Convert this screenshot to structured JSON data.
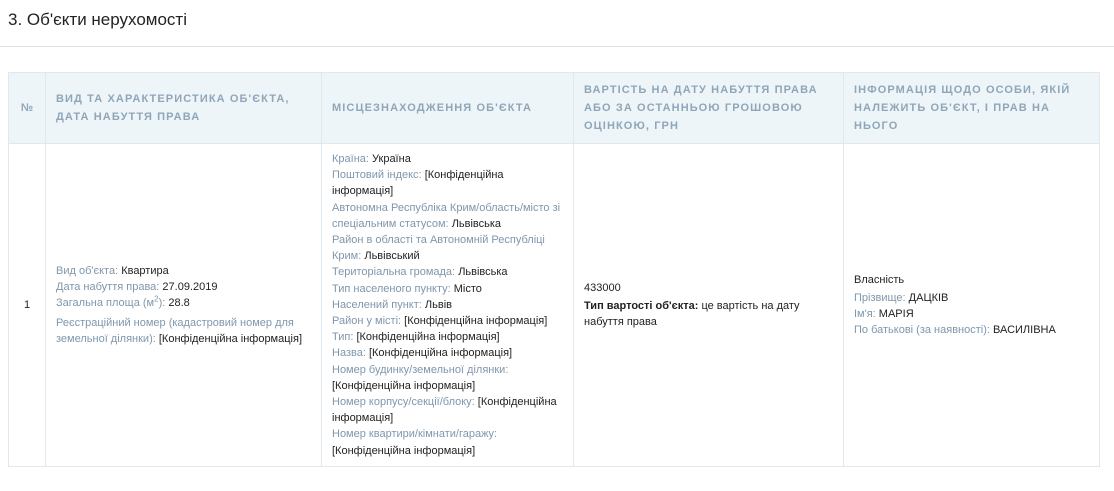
{
  "section": {
    "title": "3. Об'єкти нерухомості"
  },
  "table": {
    "headers": {
      "num": "№",
      "type": "Вид та характеристика об'єкта, дата набуття права",
      "location": "Місцезнаходження об'єкта",
      "value": "Вартість на дату набуття права або за останньою грошовою оцінкою, грн",
      "owner": "Інформація щодо особи, якій належить об'єкт, і прав на нього"
    },
    "row": {
      "num": "1",
      "type": {
        "object_type_label": "Вид об'єкта:",
        "object_type_value": "Квартира",
        "acq_date_label": "Дата набуття права:",
        "acq_date_value": "27.09.2019",
        "area_label": "Загальна площа (м",
        "area_sup": "2",
        "area_label_end": "):",
        "area_value": "28.8",
        "reg_label": "Реєстраційний номер (кадастровий номер для земельної ділянки):",
        "reg_value": "[Конфіденційна інформація]"
      },
      "location": {
        "country_label": "Країна:",
        "country_value": "Україна",
        "postal_label": "Поштовий індекс:",
        "postal_value": "[Конфіденційна інформація]",
        "region_label": "Автономна Республіка Крим/область/місто зі спеціальним статусом:",
        "region_value": "Львівська",
        "district_label": "Район в області та Автономній Республіці Крим:",
        "district_value": "Львівський",
        "community_label": "Територіальна громада:",
        "community_value": "Львівська",
        "settlement_type_label": "Тип населеного пункту:",
        "settlement_type_value": "Місто",
        "settlement_label": "Населений пункт:",
        "settlement_value": "Львів",
        "city_district_label": "Район у місті:",
        "city_district_value": "[Конфіденційна інформація]",
        "type_label": "Тип:",
        "type_value": "[Конфіденційна інформація]",
        "name_label": "Назва:",
        "name_value": "[Конфіденційна інформація]",
        "house_label": "Номер будинку/земельної ділянки:",
        "house_value": "[Конфіденційна інформація]",
        "building_label": "Номер корпусу/секції/блоку:",
        "building_value": "[Конфіденційна інформація]",
        "apartment_label": "Номер квартири/кімнати/гаражу:",
        "apartment_value": "[Конфіденційна інформація]"
      },
      "value": {
        "amount": "433000",
        "cost_type_label": "Тип вартості об'єкта:",
        "cost_type_value": "це вартість на дату набуття права"
      },
      "owner": {
        "right": "Власність",
        "surname_label": "Прізвище:",
        "surname_value": "ДАЦКІВ",
        "name_label": "Ім'я:",
        "name_value": "МАРІЯ",
        "patronymic_label": "По батькові (за наявності):",
        "patronymic_value": "ВАСИЛІВНА"
      }
    }
  }
}
